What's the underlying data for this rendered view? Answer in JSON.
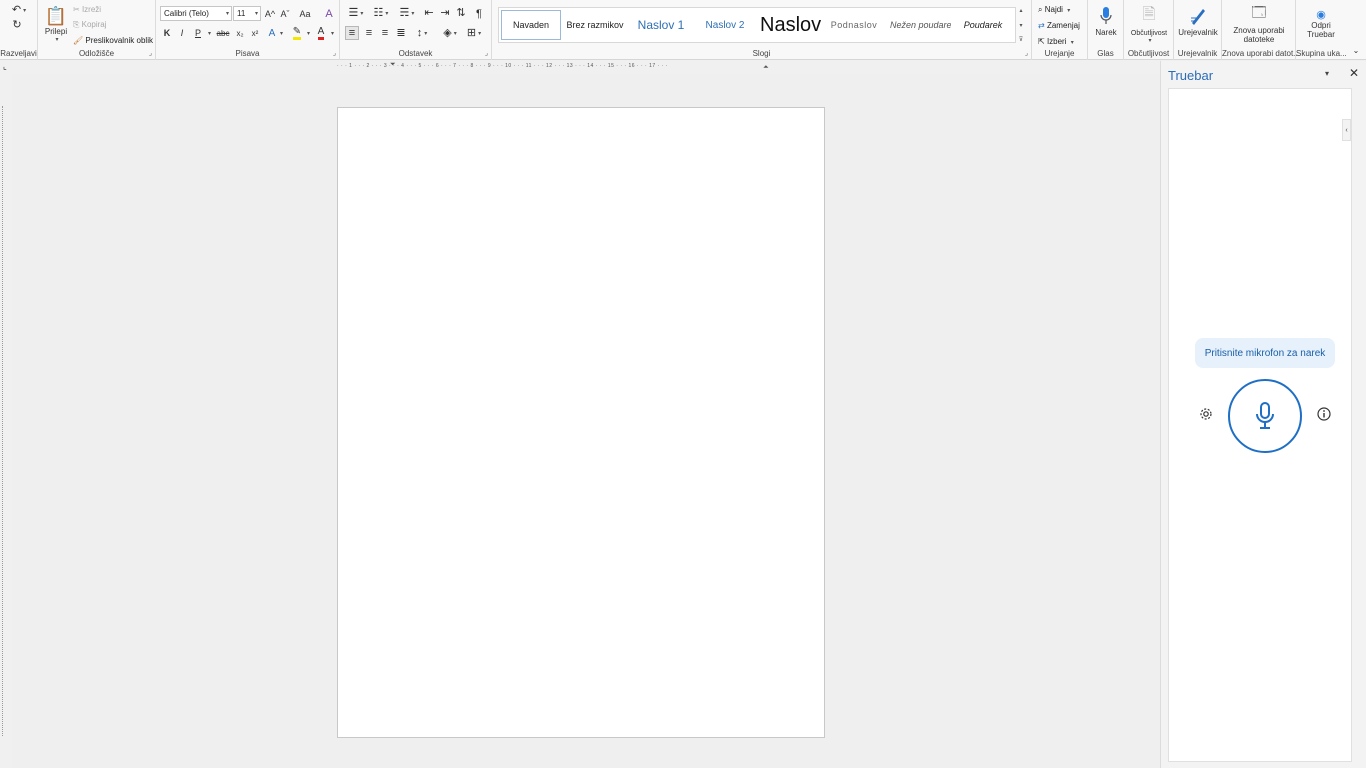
{
  "ribbon": {
    "undo": {
      "undo_icon": "undo-icon",
      "redo_icon": "redo-icon",
      "group_label": "Razveljavi"
    },
    "clipboard": {
      "paste_label": "Prilepi",
      "cut_label": "Izreži",
      "copy_label": "Kopiraj",
      "format_painter_label": "Preslikovalnik oblik",
      "group_label": "Odložišče"
    },
    "font": {
      "font_name": "Calibri (Telo)",
      "font_size": "11",
      "bold": "K",
      "italic": "I",
      "underline": "P",
      "strikethrough": "abc",
      "subscript": "x₂",
      "superscript": "x²",
      "grow": "A^",
      "shrink": "Aˇ",
      "change_case": "Aa",
      "text_effects": "A",
      "font_color": "A",
      "group_label": "Pisava"
    },
    "paragraph": {
      "show_marks": "¶",
      "group_label": "Odstavek"
    },
    "styles": {
      "items": [
        "Navaden",
        "Brez razmikov",
        "Naslov 1",
        "Naslov 2",
        "Naslov",
        "Podnaslov",
        "Nežen poudarek",
        "Poudarek"
      ],
      "group_label": "Slogi"
    },
    "editing": {
      "find_label": "Najdi",
      "replace_label": "Zamenjaj",
      "select_label": "Izberi",
      "group_label": "Urejanje"
    },
    "voice": {
      "dictate_label": "Narek",
      "group_label": "Glas"
    },
    "sensitivity": {
      "button_label": "Občutljivost",
      "group_label": "Občutljivost"
    },
    "editor": {
      "button_label": "Urejevalnik",
      "group_label": "Urejevalnik"
    },
    "reuse": {
      "button_label_line1": "Znova uporabi",
      "button_label_line2": "datoteke",
      "group_label": "Znova uporabi datot..."
    },
    "truebar": {
      "button_label_line1": "Odpri",
      "button_label_line2": "Truebar",
      "group_label": "Skupina uka..."
    }
  },
  "ruler": {
    "horizontal_marks": "· · · 1 · · · 2 · · · 3 · · · 4 · · · 5 · · · 6 · · · 7 · · · 8 · · · 9 · · · 10 · · · 11 · · · 12 · · · 13 · · · 14 · · · 15 · · · 16 · · · 17 · · ·"
  },
  "panel": {
    "title": "Truebar",
    "hint": "Pritisnite mikrofon za narek"
  },
  "colors": {
    "accent": "#1f6fc5",
    "title_blue": "#2b6cb8",
    "hint_bg": "#e6f1fb"
  }
}
